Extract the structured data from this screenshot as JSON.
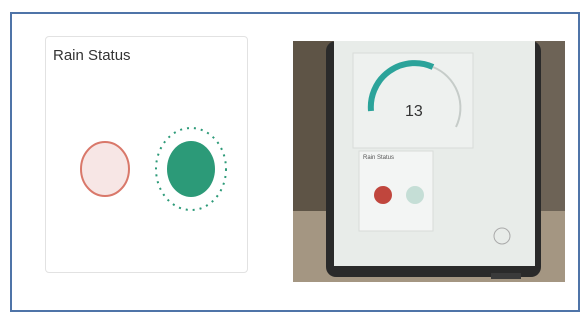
{
  "rain_card": {
    "title": "Rain Status",
    "indicator_off_color": "#f7e6e5",
    "indicator_off_border": "#d9786a",
    "indicator_on_color": "#2c9a78"
  },
  "photo": {
    "gauge_value": "13",
    "mini_title": "Rain Status"
  }
}
